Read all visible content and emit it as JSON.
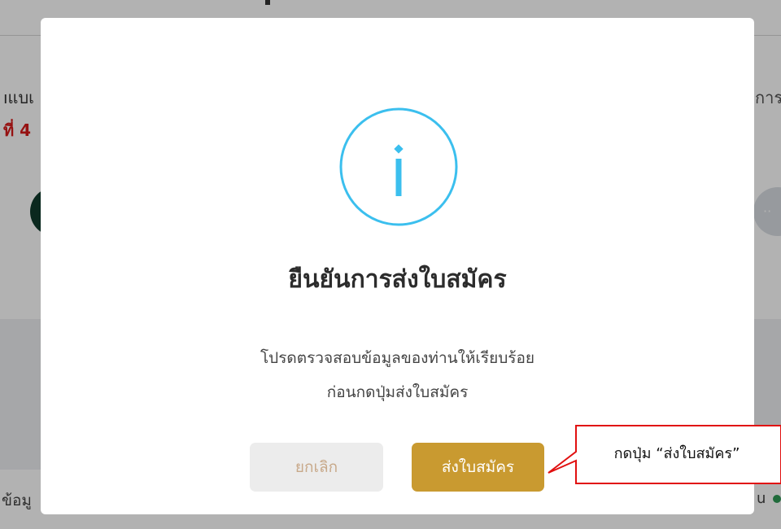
{
  "background": {
    "left_text": "ıแบเ",
    "left_red_text": "ที่ 4",
    "right_text": "การ",
    "bottom_left_text": "ข้อมู",
    "bottom_right_text": "u"
  },
  "modal": {
    "icon": "info-icon",
    "title": "ยืนยันการส่งใบสมัคร",
    "message_line1": "โปรดตรวจสอบข้อมูลของท่านให้เรียบร้อย",
    "message_line2": "ก่อนกดปุ่มส่งใบสมัคร",
    "cancel_label": "ยกเลิก",
    "submit_label": "ส่งใบสมัคร"
  },
  "annotation": {
    "text": "กดปุ่ม “ส่งใบสมัคร”"
  },
  "colors": {
    "icon_blue": "#3bbfee",
    "submit_gold": "#c99a30",
    "cancel_grey": "#ececec",
    "callout_red": "#e11010"
  }
}
